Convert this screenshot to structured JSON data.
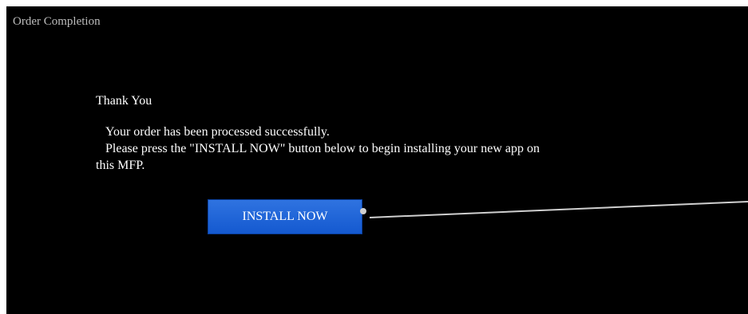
{
  "window": {
    "title": "Order Completion"
  },
  "message": {
    "heading": "Thank You",
    "line1": "Your order has been processed successfully.",
    "line2": "Please press the \"INSTALL NOW\" button below to begin installing your new app on",
    "line3": "this MFP."
  },
  "actions": {
    "install_label": "INSTALL NOW"
  },
  "colors": {
    "background": "#000000",
    "button": "#1e63d8",
    "text": "#ffffff",
    "title": "#bdbdbd",
    "callout": "#cfcfcf"
  }
}
